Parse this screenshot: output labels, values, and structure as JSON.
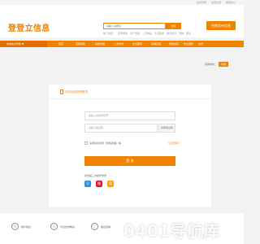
{
  "top_links": [
    "会员登录",
    "免费注册",
    "客服中心"
  ],
  "header": {
    "logo_text": "登登立信息",
    "search_placeholder": "请输入关键词",
    "search_button": "搜索",
    "hot_words": [
      "热门搜索：",
      "招聘求职",
      "房产出租",
      "二手物品",
      "生活服务",
      "教育培训",
      "宠物",
      "更多"
    ],
    "post_button": "免费发布信息"
  },
  "nav": {
    "items": [
      "本地信息导航 ▼",
      "首页",
      "招聘求职",
      "房屋出租",
      "二手市场",
      "生活服务",
      "车辆买卖",
      "宠物领养",
      "商业服务",
      "资讯"
    ]
  },
  "location": {
    "label": "切换城市：",
    "button": "切换"
  },
  "login": {
    "title": "手机动态密码登录",
    "phone_placeholder": "请输入您的手机号",
    "code_placeholder": "请输入验证码",
    "code_button": "获取验证码",
    "agree_text": "请阅读并同意《隐私政策》等",
    "forgot_text": "忘记密码？",
    "submit": "登 录",
    "third_party_label": "使用第三方帐号登录",
    "social": [
      {
        "name": "qq-icon",
        "glyph": "Q",
        "color": "#2b8de0"
      },
      {
        "name": "weibo-icon",
        "glyph": "微",
        "color": "#e6162d"
      },
      {
        "name": "wechat-icon",
        "glyph": "微",
        "color": "#ff9f00"
      }
    ]
  },
  "footer": {
    "items": [
      "商户信息",
      "平台合作联系",
      "信息咨询",
      "客服帮助"
    ]
  },
  "watermark": "0401导航库"
}
